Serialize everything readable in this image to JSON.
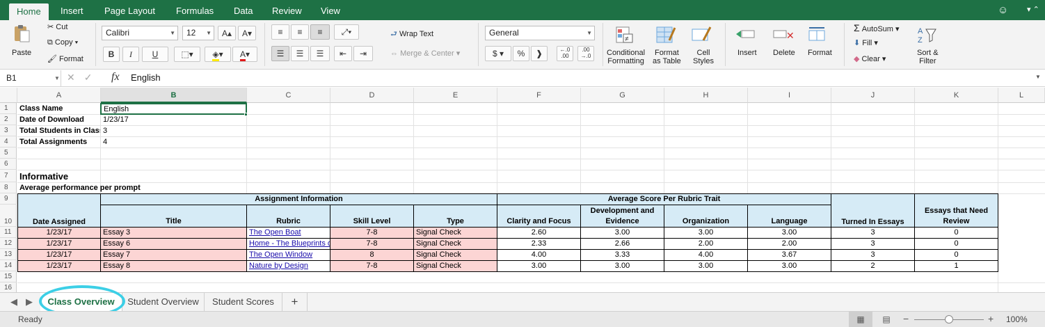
{
  "ribbon_tabs": [
    "Home",
    "Insert",
    "Page Layout",
    "Formulas",
    "Data",
    "Review",
    "View"
  ],
  "clipboard": {
    "paste": "Paste",
    "cut": "Cut",
    "copy": "Copy",
    "format": "Format"
  },
  "font": {
    "name": "Calibri",
    "size": "12",
    "bold": "B",
    "italic": "I",
    "underline": "U"
  },
  "alignment": {
    "wrap_text": "Wrap Text",
    "merge_center": "Merge & Center"
  },
  "number": {
    "format": "General",
    "currency": "$",
    "percent": "%",
    "comma": "❱",
    "inc_decimal": "←.0\n.00",
    "dec_decimal": ".00\n→.0"
  },
  "styles": {
    "conditional": "Conditional\nFormatting",
    "format_table": "Format\nas Table",
    "cell_styles": "Cell\nStyles"
  },
  "cells_group": {
    "insert": "Insert",
    "delete": "Delete",
    "format": "Format"
  },
  "editing": {
    "autosum": "AutoSum",
    "fill": "Fill",
    "clear": "Clear",
    "sort_filter": "Sort &\nFilter"
  },
  "formula_bar": {
    "name_box": "B1",
    "fx": "fx",
    "content": "English"
  },
  "columns": [
    "A",
    "B",
    "C",
    "D",
    "E",
    "F",
    "G",
    "H",
    "I",
    "J",
    "K",
    "L"
  ],
  "rows": [
    "1",
    "2",
    "3",
    "4",
    "5",
    "6",
    "7",
    "8",
    "9",
    "10",
    "11",
    "12",
    "13",
    "14",
    "15",
    "16"
  ],
  "info": {
    "class_name_label": "Class Name",
    "class_name": "English",
    "date_label": "Date of Download",
    "date": "1/23/17",
    "students_label": "Total Students in Class",
    "students": "3",
    "assignments_label": "Total Assignments",
    "assignments": "4"
  },
  "section": {
    "title": "Informative",
    "subtitle": "Average performance per prompt"
  },
  "table": {
    "group_assignment": "Assignment Information",
    "group_rubric": "Average Score Per Rubric Trait",
    "headers": {
      "date": "Date Assigned",
      "title": "Title",
      "rubric": "Rubric",
      "skill": "Skill Level",
      "type": "Type",
      "clarity": "Clarity and Focus",
      "development": "Development and\nEvidence",
      "organization": "Organization",
      "language": "Language",
      "turned_in": "Turned In Essays",
      "need_review": "Essays that Need\nReview"
    },
    "rows": [
      {
        "date": "1/23/17",
        "title": "Essay 3",
        "rubric": "The Open Boat",
        "skill": "7-8",
        "type": "Signal Check",
        "clarity": "2.60",
        "development": "3.00",
        "organization": "3.00",
        "language": "3.00",
        "turned_in": "3",
        "need_review": "0"
      },
      {
        "date": "1/23/17",
        "title": "Essay 6",
        "rubric": "Home - The Blueprints o",
        "skill": "7-8",
        "type": "Signal Check",
        "clarity": "2.33",
        "development": "2.66",
        "organization": "2.00",
        "language": "2.00",
        "turned_in": "3",
        "need_review": "0"
      },
      {
        "date": "1/23/17",
        "title": "Essay 7",
        "rubric": "The Open Window",
        "skill": "8",
        "type": "Signal Check",
        "clarity": "4.00",
        "development": "3.33",
        "organization": "4.00",
        "language": "3.67",
        "turned_in": "3",
        "need_review": "0"
      },
      {
        "date": "1/23/17",
        "title": "Essay 8",
        "rubric": "Nature by Design",
        "skill": "7-8",
        "type": "Signal Check",
        "clarity": "3.00",
        "development": "3.00",
        "organization": "3.00",
        "language": "3.00",
        "turned_in": "2",
        "need_review": "1"
      }
    ]
  },
  "sheet_tabs": [
    "Class Overview",
    "Student Overview",
    "Student Scores"
  ],
  "add_sheet": "+",
  "status": {
    "ready": "Ready",
    "zoom": "100%"
  },
  "colors": {
    "brand": "#1e7145",
    "header_fill": "#d6ebf6",
    "row_fill": "#fcd5d4",
    "highlight_circle": "#3ccfe6"
  }
}
